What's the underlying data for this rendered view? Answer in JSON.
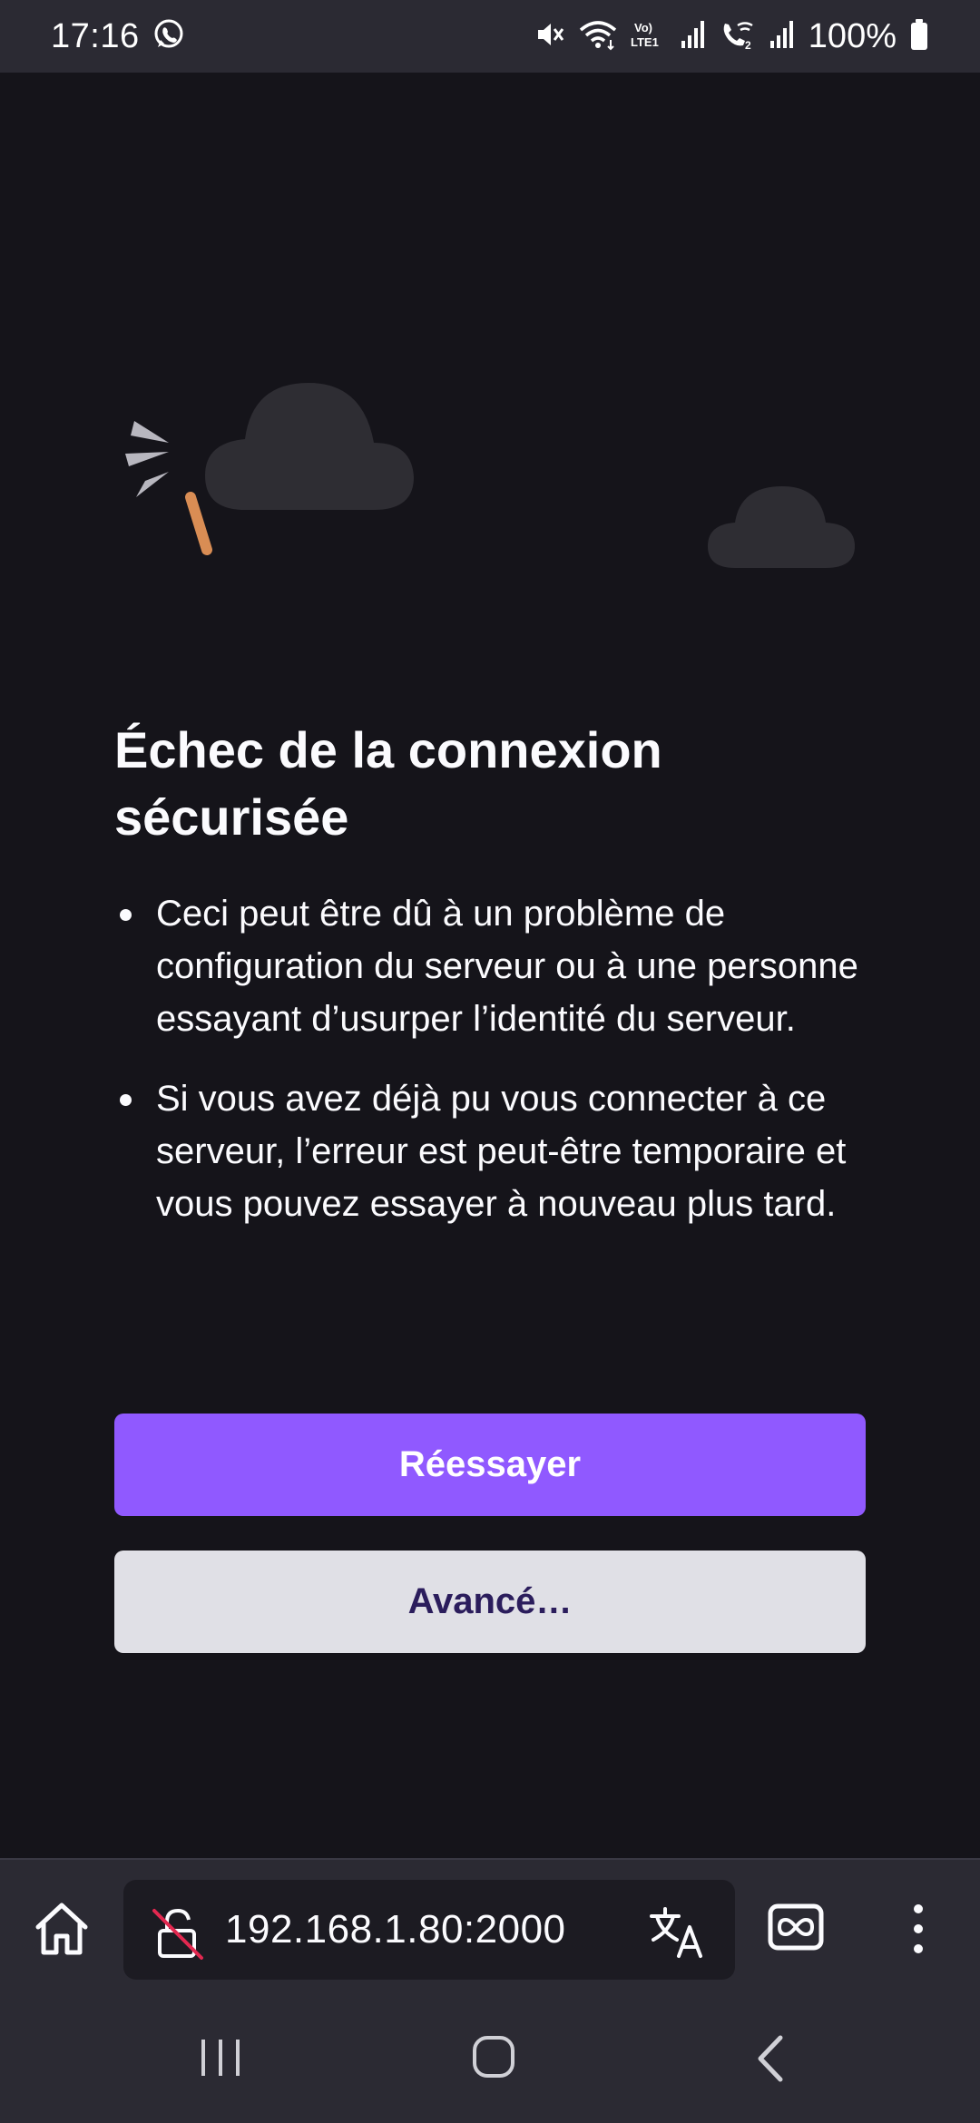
{
  "status_bar": {
    "time": "17:16",
    "battery": "100%",
    "icons": [
      "whatsapp-icon",
      "mute-icon",
      "wifi-icon",
      "volte-icon",
      "signal-icon",
      "wifi-calling-icon",
      "signal-icon",
      "battery-icon"
    ]
  },
  "error_page": {
    "title": "Échec de la connexion sécurisée",
    "bullets": [
      "Ceci peut être dû à un problème de configuration du serveur ou à une personne essayant d’usurper l’identité du serveur.",
      "Si vous avez déjà pu vous connecter à ce serveur, l’erreur est peut-être temporaire et vous pouvez essayer à nouveau plus tard."
    ],
    "retry_label": "Réessayer",
    "advanced_label": "Avancé…"
  },
  "toolbar": {
    "url": "192.168.1.80:2000",
    "icons": [
      "home-icon",
      "insecure-lock-icon",
      "translate-icon",
      "tabs-icon",
      "menu-icon"
    ]
  },
  "colors": {
    "background": "#15141a",
    "accent": "#9059ff",
    "secondary_button": "#e0e0e6",
    "toolbar": "#2b2a33"
  }
}
